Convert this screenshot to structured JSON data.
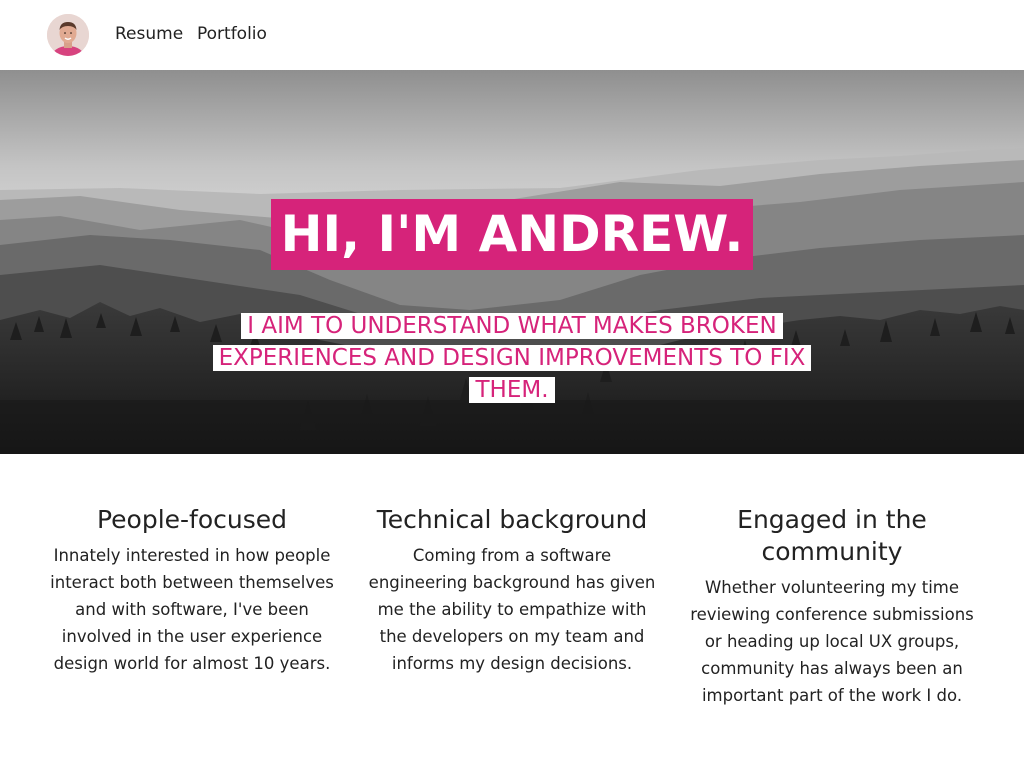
{
  "nav": {
    "avatar_icon": "user-avatar",
    "links": [
      "Resume",
      "Portfolio"
    ]
  },
  "hero": {
    "headline": "HI, I'M ANDREW.",
    "tagline": "I AIM TO UNDERSTAND WHAT MAKES BROKEN EXPERIENCES AND DESIGN IMPROVEMENTS TO FIX THEM.",
    "accent_color": "#d6237a"
  },
  "features": [
    {
      "title": "People-focused",
      "body": "Innately interested in how people interact both between themselves and with software, I've been involved in the user experience design world for almost 10 years."
    },
    {
      "title": "Technical background",
      "body": "Coming from a software engineering background has given me the ability to empathize with the developers on my team and informs my design decisions."
    },
    {
      "title": "Engaged in the community",
      "body": "Whether volunteering my time reviewing conference submissions or heading up local UX groups, community has always been an important part of the work I do."
    }
  ]
}
